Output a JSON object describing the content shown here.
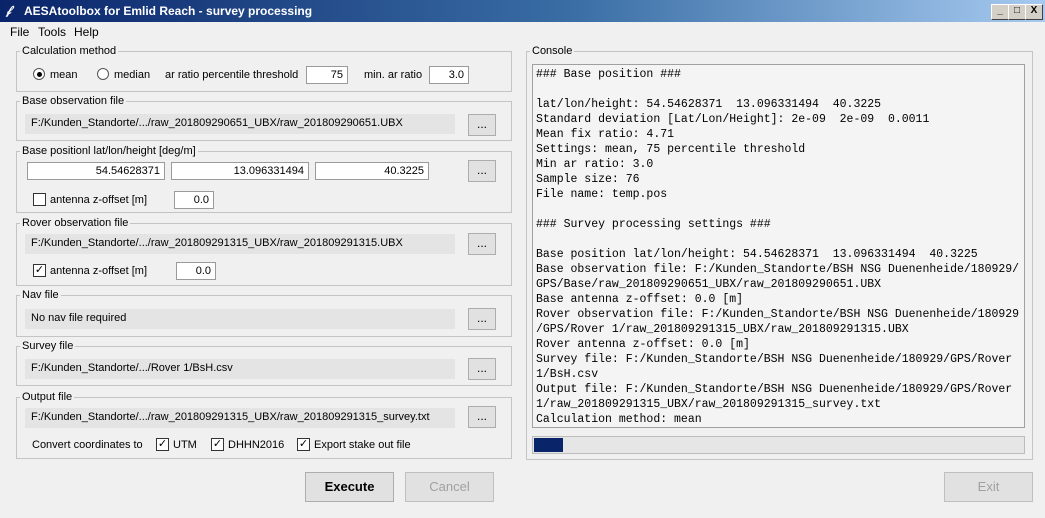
{
  "window": {
    "title": "AESAtoolbox for Emlid Reach - survey processing",
    "minimize": "_",
    "maximize": "□",
    "close": "X"
  },
  "menu": [
    "File",
    "Tools",
    "Help"
  ],
  "calc": {
    "title": "Calculation method",
    "mean_label": "mean",
    "median_label": "median",
    "selected": "mean",
    "ar_label": "ar ratio percentile threshold",
    "ar_value": "75",
    "min_ar_label": "min. ar ratio",
    "min_ar_value": "3.0"
  },
  "base_obs": {
    "title": "Base observation file",
    "path": "F:/Kunden_Standorte/.../raw_201809290651_UBX/raw_201809290651.UBX",
    "browse": "..."
  },
  "base_pos": {
    "title": "Base positionl lat/lon/height [deg/m]",
    "lat": "54.54628371",
    "lon": "13.096331494",
    "height": "40.3225",
    "browse": "...",
    "offset_label": "antenna z-offset [m]",
    "offset_value": "0.0",
    "offset_checked": false
  },
  "rover_obs": {
    "title": "Rover observation file",
    "path": "F:/Kunden_Standorte/.../raw_201809291315_UBX/raw_201809291315.UBX",
    "browse": "...",
    "offset_label": "antenna z-offset [m]",
    "offset_value": "0.0",
    "offset_checked": true
  },
  "nav": {
    "title": "Nav file",
    "path": "No nav file required",
    "browse": "..."
  },
  "survey": {
    "title": "Survey file",
    "path": "F:/Kunden_Standorte/.../Rover 1/BsH.csv",
    "browse": "..."
  },
  "output": {
    "title": "Output file",
    "path": "F:/Kunden_Standorte/.../raw_201809291315_UBX/raw_201809291315_survey.txt",
    "browse": "...",
    "convert_label": "Convert coordinates to",
    "utm_label": "UTM",
    "dhhn_label": "DHHN2016",
    "stake_label": "Export stake out file"
  },
  "console": {
    "title": "Console",
    "lines": [
      "### Base position ###",
      "",
      "lat/lon/height: 54.54628371  13.096331494  40.3225",
      "Standard deviation [Lat/Lon/Height]: 2e-09  2e-09  0.0011",
      "Mean fix ratio: 4.71",
      "Settings: mean, 75 percentile threshold",
      "Min ar ratio: 3.0",
      "Sample size: 76",
      "File name: temp.pos",
      "",
      "### Survey processing settings ###",
      "",
      "Base position lat/lon/height: 54.54628371  13.096331494  40.3225",
      "Base observation file: F:/Kunden_Standorte/BSH NSG Duenenheide/180929/",
      "GPS/Base/raw_201809290651_UBX/raw_201809290651.UBX",
      "Base antenna z-offset: 0.0 [m]",
      "Rover observation file: F:/Kunden_Standorte/BSH NSG Duenenheide/180929",
      "/GPS/Rover 1/raw_201809291315_UBX/raw_201809291315.UBX",
      "Rover antenna z-offset: 0.0 [m]",
      "Survey file: F:/Kunden_Standorte/BSH NSG Duenenheide/180929/GPS/Rover",
      "1/BsH.csv",
      "Output file: F:/Kunden_Standorte/BSH NSG Duenenheide/180929/GPS/Rover",
      "1/raw_201809291315_UBX/raw_201809291315_survey.txt",
      "Calculation method: mean"
    ],
    "progress": 0.06,
    "accent": "#0a246a"
  },
  "buttons": {
    "execute": "Execute",
    "cancel": "Cancel",
    "exit": "Exit"
  }
}
